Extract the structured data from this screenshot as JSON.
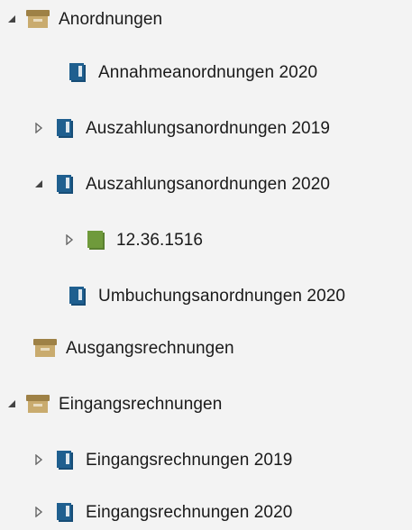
{
  "tree": {
    "items": [
      {
        "label": "Anordnungen",
        "icon": "archive-box-icon",
        "state": "expanded"
      },
      {
        "label": "Annahmeanordnungen 2020",
        "icon": "blue-book-icon",
        "state": "leaf"
      },
      {
        "label": "Auszahlungsanordnungen 2019",
        "icon": "blue-book-icon",
        "state": "collapsed"
      },
      {
        "label": "Auszahlungsanordnungen 2020",
        "icon": "blue-book-icon",
        "state": "expanded"
      },
      {
        "label": "12.36.1516",
        "icon": "green-book-icon",
        "state": "collapsed"
      },
      {
        "label": "Umbuchungsanordnungen 2020",
        "icon": "blue-book-icon",
        "state": "leaf"
      },
      {
        "label": "Ausgangsrechnungen",
        "icon": "archive-box-icon",
        "state": "leaf"
      },
      {
        "label": "Eingangsrechnungen",
        "icon": "archive-box-icon",
        "state": "expanded"
      },
      {
        "label": "Eingangsrechnungen 2019",
        "icon": "blue-book-icon",
        "state": "collapsed"
      },
      {
        "label": "Eingangsrechnungen 2020",
        "icon": "blue-book-icon",
        "state": "collapsed"
      }
    ]
  },
  "colors": {
    "book_blue": "#1f5f8f",
    "book_green": "#6f9a3b",
    "archive_tan": "#b9995a",
    "arrow": "#444444"
  }
}
